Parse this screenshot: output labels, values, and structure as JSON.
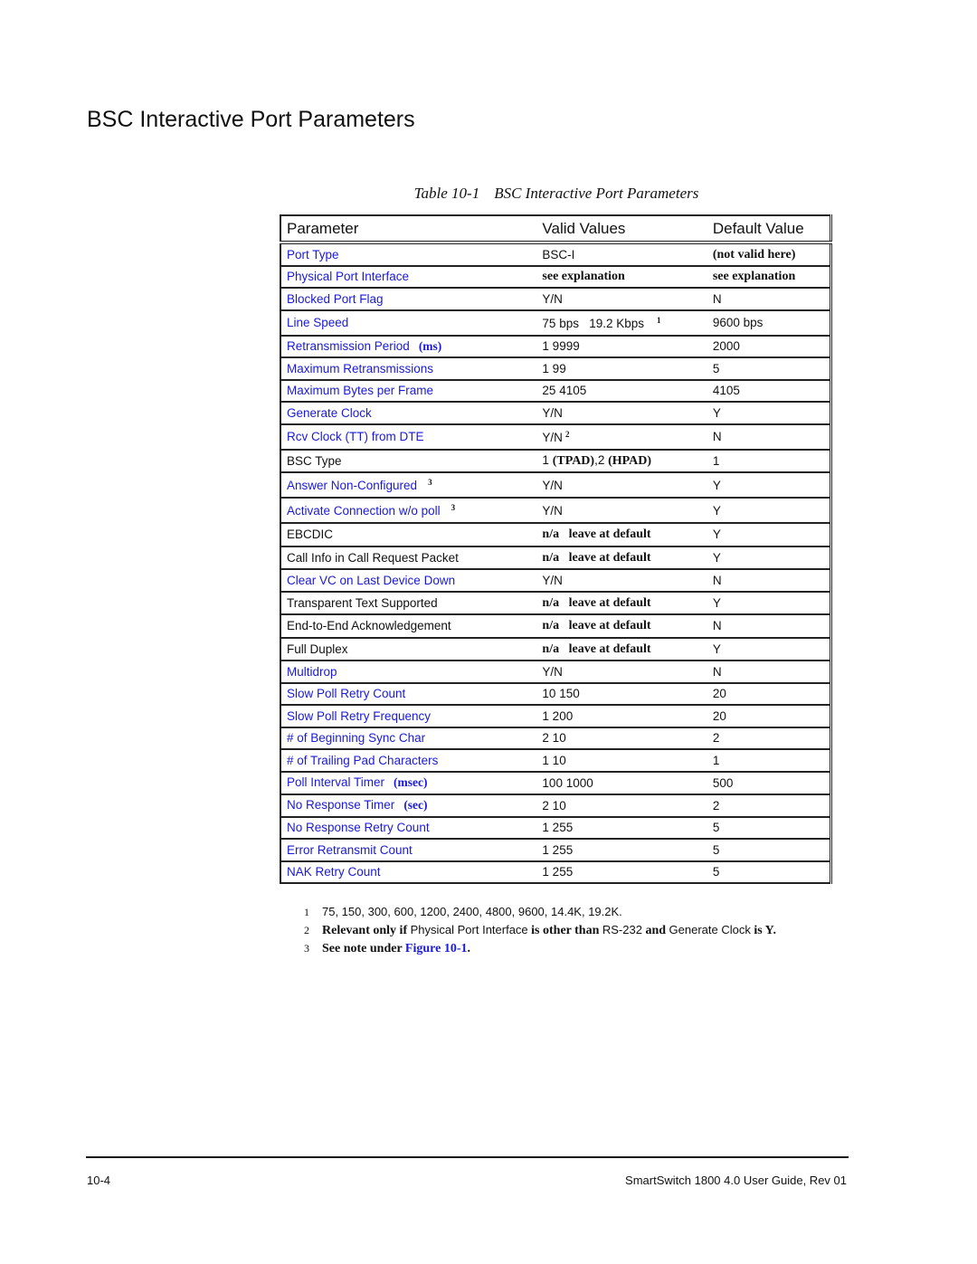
{
  "section_title": "BSC Interactive Port Parameters",
  "table": {
    "caption_number": "Table 10-1",
    "caption_title": "BSC Interactive Port Parameters",
    "headers": [
      "Parameter",
      "Valid Values",
      "Default Value"
    ],
    "rows": [
      {
        "parameter": "Port Type",
        "unit": "",
        "sup": "",
        "link": true,
        "valid": "BSC-I",
        "valid_style": "plain",
        "valid_sup": "",
        "default": "(not valid here)",
        "default_style": "serif-bold",
        "size": "r24"
      },
      {
        "parameter": "Physical Port Interface",
        "unit": "",
        "sup": "",
        "link": true,
        "valid": "see explanation",
        "valid_style": "serif-bold",
        "valid_sup": "",
        "default": "see explanation",
        "default_style": "serif-bold",
        "size": "r24"
      },
      {
        "parameter": "Blocked Port Flag",
        "unit": "",
        "sup": "",
        "link": true,
        "valid": "Y/N",
        "valid_style": "plain",
        "valid_sup": "",
        "default": "N",
        "default_style": "plain",
        "size": "r24"
      },
      {
        "parameter": "Line Speed",
        "unit": "",
        "sup": "",
        "link": true,
        "valid": "75 bps   19.2 Kbps",
        "valid_style": "plain",
        "valid_sup": "1",
        "default": "9600 bps",
        "default_style": "plain",
        "size": "r28"
      },
      {
        "parameter": "Retransmission Period",
        "unit": "(ms)",
        "sup": "",
        "link": true,
        "valid": "1 9999",
        "valid_style": "plain",
        "valid_sup": "",
        "default": "2000",
        "default_style": "plain",
        "size": "r24"
      },
      {
        "parameter": "Maximum Retransmissions",
        "unit": "",
        "sup": "",
        "link": true,
        "valid": "1 99",
        "valid_style": "plain",
        "valid_sup": "",
        "default": "5",
        "default_style": "plain",
        "size": "r24"
      },
      {
        "parameter": "Maximum Bytes per Frame",
        "unit": "",
        "sup": "",
        "link": true,
        "valid": "25 4105",
        "valid_style": "plain",
        "valid_sup": "",
        "default": "4105",
        "default_style": "plain",
        "size": "r24"
      },
      {
        "parameter": "Generate Clock",
        "unit": "",
        "sup": "",
        "link": true,
        "valid": "Y/N",
        "valid_style": "plain",
        "valid_sup": "",
        "default": "Y",
        "default_style": "plain",
        "size": "r24"
      },
      {
        "parameter": "Rcv Clock (TT) from DTE",
        "unit": "",
        "sup": "",
        "link": true,
        "valid": "Y/N",
        "valid_style": "plain",
        "valid_sup": "2",
        "default": "N",
        "default_style": "plain",
        "size": "r28"
      },
      {
        "parameter": "BSC Type",
        "unit": "",
        "sup": "",
        "link": false,
        "valid": "1 (TPAD),2 (HPAD)",
        "valid_style": "mixed",
        "valid_sup": "",
        "default": "1",
        "default_style": "plain",
        "size": "r25"
      },
      {
        "parameter": "Answer Non-Configured",
        "unit": "",
        "sup": "3",
        "link": true,
        "valid": "Y/N",
        "valid_style": "plain",
        "valid_sup": "",
        "default": "Y",
        "default_style": "plain",
        "size": "r28"
      },
      {
        "parameter": "Activate Connection w/o poll",
        "unit": "",
        "sup": "3",
        "link": true,
        "valid": "Y/N",
        "valid_style": "plain",
        "valid_sup": "",
        "default": "Y",
        "default_style": "plain",
        "size": "r28"
      },
      {
        "parameter": "EBCDIC",
        "unit": "",
        "sup": "",
        "link": false,
        "valid": "n/a   leave at default",
        "valid_style": "serif-bold",
        "valid_sup": "",
        "default": "Y",
        "default_style": "plain",
        "size": "r25"
      },
      {
        "parameter": "Call Info in Call Request Packet",
        "unit": "",
        "sup": "",
        "link": false,
        "valid": "n/a   leave at default",
        "valid_style": "serif-bold",
        "valid_sup": "",
        "default": "Y",
        "default_style": "plain",
        "size": "r25"
      },
      {
        "parameter": "Clear VC on Last Device Down",
        "unit": "",
        "sup": "",
        "link": true,
        "valid": "Y/N",
        "valid_style": "plain",
        "valid_sup": "",
        "default": "N",
        "default_style": "plain",
        "size": "r24"
      },
      {
        "parameter": "Transparent Text Supported",
        "unit": "",
        "sup": "",
        "link": false,
        "valid": "n/a   leave at default",
        "valid_style": "serif-bold",
        "valid_sup": "",
        "default": "Y",
        "default_style": "plain",
        "size": "r25"
      },
      {
        "parameter": "End-to-End Acknowledgement",
        "unit": "",
        "sup": "",
        "link": false,
        "valid": "n/a   leave at default",
        "valid_style": "serif-bold",
        "valid_sup": "",
        "default": "N",
        "default_style": "plain",
        "size": "r25"
      },
      {
        "parameter": "Full Duplex",
        "unit": "",
        "sup": "",
        "link": false,
        "valid": "n/a   leave at default",
        "valid_style": "serif-bold",
        "valid_sup": "",
        "default": "Y",
        "default_style": "plain",
        "size": "r25"
      },
      {
        "parameter": "Multidrop",
        "unit": "",
        "sup": "",
        "link": true,
        "valid": "Y/N",
        "valid_style": "plain",
        "valid_sup": "",
        "default": "N",
        "default_style": "plain",
        "size": "r24"
      },
      {
        "parameter": "Slow Poll Retry Count",
        "unit": "",
        "sup": "",
        "link": true,
        "valid": "10 150",
        "valid_style": "plain",
        "valid_sup": "",
        "default": "20",
        "default_style": "plain",
        "size": "r24"
      },
      {
        "parameter": "Slow Poll Retry Frequency",
        "unit": "",
        "sup": "",
        "link": true,
        "valid": "1 200",
        "valid_style": "plain",
        "valid_sup": "",
        "default": "20",
        "default_style": "plain",
        "size": "r24"
      },
      {
        "parameter": "# of Beginning Sync Char",
        "unit": "",
        "sup": "",
        "link": true,
        "valid": "2 10",
        "valid_style": "plain",
        "valid_sup": "",
        "default": "2",
        "default_style": "plain",
        "size": "r24"
      },
      {
        "parameter": "# of Trailing Pad Characters",
        "unit": "",
        "sup": "",
        "link": true,
        "valid": "1 10",
        "valid_style": "plain",
        "valid_sup": "",
        "default": "1",
        "default_style": "plain",
        "size": "r24"
      },
      {
        "parameter": "Poll Interval Timer",
        "unit": "(msec)",
        "sup": "",
        "link": true,
        "valid": "100 1000",
        "valid_style": "plain",
        "valid_sup": "",
        "default": "500",
        "default_style": "plain",
        "size": "r25"
      },
      {
        "parameter": "No Response Timer",
        "unit": "(sec)",
        "sup": "",
        "link": true,
        "valid": "2 10",
        "valid_style": "plain",
        "valid_sup": "",
        "default": "2",
        "default_style": "plain",
        "size": "r24"
      },
      {
        "parameter": "No Response Retry Count",
        "unit": "",
        "sup": "",
        "link": true,
        "valid": "1 255",
        "valid_style": "plain",
        "valid_sup": "",
        "default": "5",
        "default_style": "plain",
        "size": "r24"
      },
      {
        "parameter": "Error Retransmit Count",
        "unit": "",
        "sup": "",
        "link": true,
        "valid": "1 255",
        "valid_style": "plain",
        "valid_sup": "",
        "default": "5",
        "default_style": "plain",
        "size": "r24"
      },
      {
        "parameter": "NAK Retry Count",
        "unit": "",
        "sup": "",
        "link": true,
        "valid": "1 255",
        "valid_style": "plain",
        "valid_sup": "",
        "default": "5",
        "default_style": "plain",
        "size": "r24"
      }
    ]
  },
  "footnotes": {
    "fn1": {
      "num": "1",
      "text": "75, 150, 300, 600, 1200, 2400, 4800, 9600, 14.4K, 19.2K."
    },
    "fn2": {
      "num": "2",
      "a": "Relevant only if ",
      "b": "Physical Port Interface",
      "c": " is other than ",
      "d": "RS-232",
      "e": " and ",
      "f": "Generate Clock",
      "g": " is Y."
    },
    "fn3": {
      "num": "3",
      "a": "See note under ",
      "link": "Figure 10-1",
      "b": "."
    }
  },
  "footer": {
    "page_number": "10-4",
    "doc_title": "SmartSwitch 1800 4.0 User Guide, Rev 01"
  }
}
